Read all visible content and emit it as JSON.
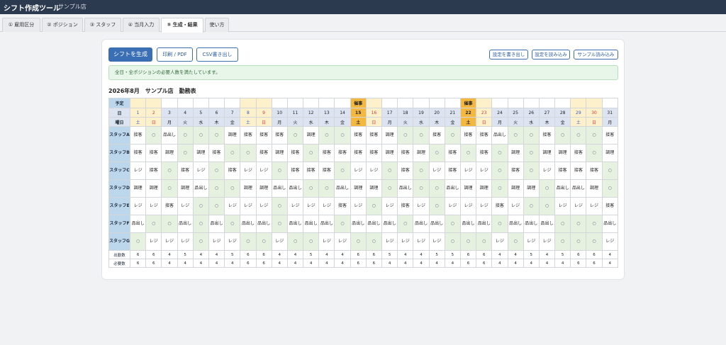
{
  "header": {
    "title": "シフト作成ツール",
    "store": "サンプル店"
  },
  "tabs": [
    {
      "label": "① 雇用区分",
      "name": "tab-employment"
    },
    {
      "label": "② ポジション",
      "name": "tab-position"
    },
    {
      "label": "③ スタッフ",
      "name": "tab-staff"
    },
    {
      "label": "④ 当月入力",
      "name": "tab-monthly-input"
    },
    {
      "label": "⑤ 生成・結果",
      "name": "tab-generate-result"
    },
    {
      "label": "使い方",
      "name": "tab-help"
    }
  ],
  "toolbar": {
    "generate": "シフトを生成",
    "print": "印刷 / PDF",
    "csv": "CSV書き出し",
    "export_settings": "設定を書き出し",
    "import_settings": "設定を読み込み",
    "load_sample": "サンプル読み込み"
  },
  "alert": "全日・全ポジションの必要人数を満たしています。",
  "sheet_title": "2026年8月　サンプル店　勤務表",
  "labels": {
    "event": "予定",
    "day": "日",
    "weekday": "曜日",
    "worked": "出勤数",
    "required": "必要数"
  },
  "days": [
    "1",
    "2",
    "3",
    "4",
    "5",
    "6",
    "7",
    "8",
    "9",
    "10",
    "11",
    "12",
    "13",
    "14",
    "15",
    "16",
    "17",
    "18",
    "19",
    "20",
    "21",
    "22",
    "23",
    "24",
    "25",
    "26",
    "27",
    "28",
    "29",
    "30",
    "31"
  ],
  "weekdays": [
    "土",
    "日",
    "月",
    "火",
    "水",
    "木",
    "金",
    "土",
    "日",
    "月",
    "火",
    "水",
    "木",
    "金",
    "土",
    "日",
    "月",
    "火",
    "水",
    "木",
    "金",
    "土",
    "日",
    "月",
    "火",
    "水",
    "木",
    "金",
    "土",
    "日",
    "月"
  ],
  "events": [
    "",
    "",
    "",
    "",
    "",
    "",
    "",
    "",
    "",
    "",
    "",
    "",
    "",
    "",
    "催事",
    "",
    "",
    "",
    "",
    "",
    "",
    "催事",
    "",
    "",
    "",
    "",
    "",
    "",
    "",
    "",
    ""
  ],
  "staff": [
    {
      "name": "スタッフA",
      "shifts": [
        "接客",
        "○",
        "品出し",
        "○",
        "○",
        "○",
        "調理",
        "接客",
        "接客",
        "接客",
        "○",
        "調理",
        "○",
        "○",
        "接客",
        "接客",
        "調理",
        "○",
        "○",
        "接客",
        "○",
        "接客",
        "接客",
        "品出し",
        "○",
        "○",
        "接客",
        "○",
        "○",
        "○",
        "接客"
      ]
    },
    {
      "name": "スタッフB",
      "shifts": [
        "接客",
        "接客",
        "調理",
        "○",
        "調理",
        "接客",
        "○",
        "○",
        "接客",
        "調理",
        "接客",
        "○",
        "接客",
        "接客",
        "接客",
        "接客",
        "調理",
        "接客",
        "調理",
        "○",
        "接客",
        "○",
        "接客",
        "○",
        "調理",
        "○",
        "調理",
        "調理",
        "接客",
        "○",
        "調理"
      ]
    },
    {
      "name": "スタッフC",
      "shifts": [
        "レジ",
        "接客",
        "○",
        "接客",
        "レジ",
        "○",
        "接客",
        "レジ",
        "レジ",
        "○",
        "接客",
        "接客",
        "接客",
        "○",
        "レジ",
        "レジ",
        "○",
        "接客",
        "○",
        "レジ",
        "接客",
        "レジ",
        "レジ",
        "○",
        "接客",
        "○",
        "レジ",
        "接客",
        "接客",
        "接客",
        "○"
      ]
    },
    {
      "name": "スタッフD",
      "shifts": [
        "調理",
        "調理",
        "○",
        "調理",
        "品出し",
        "○",
        "○",
        "調理",
        "調理",
        "品出し",
        "品出し",
        "○",
        "○",
        "品出し",
        "調理",
        "調理",
        "○",
        "品出し",
        "○",
        "○",
        "品出し",
        "調理",
        "調理",
        "○",
        "調理",
        "調理",
        "○",
        "品出し",
        "品出し",
        "調理",
        "○"
      ]
    },
    {
      "name": "スタッフE",
      "shifts": [
        "レジ",
        "レジ",
        "接客",
        "レジ",
        "○",
        "○",
        "レジ",
        "レジ",
        "レジ",
        "○",
        "レジ",
        "レジ",
        "レジ",
        "接客",
        "レジ",
        "○",
        "レジ",
        "接客",
        "レジ",
        "○",
        "レジ",
        "レジ",
        "レジ",
        "接客",
        "レジ",
        "○",
        "○",
        "レジ",
        "レジ",
        "レジ",
        "接客"
      ]
    },
    {
      "name": "スタッフF",
      "shifts": [
        "品出し",
        "○",
        "○",
        "品出し",
        "○",
        "品出し",
        "○",
        "品出し",
        "品出し",
        "○",
        "品出し",
        "品出し",
        "品出し",
        "○",
        "品出し",
        "品出し",
        "品出し",
        "○",
        "品出し",
        "品出し",
        "○",
        "品出し",
        "品出し",
        "○",
        "品出し",
        "品出し",
        "品出し",
        "○",
        "○",
        "○",
        "品出し"
      ]
    },
    {
      "name": "スタッフG",
      "shifts": [
        "○",
        "レジ",
        "レジ",
        "レジ",
        "○",
        "レジ",
        "レジ",
        "○",
        "○",
        "レジ",
        "○",
        "○",
        "レジ",
        "レジ",
        "○",
        "○",
        "レジ",
        "レジ",
        "レジ",
        "レジ",
        "○",
        "○",
        "○",
        "レジ",
        "○",
        "レジ",
        "レジ",
        "○",
        "○",
        "○",
        "レジ"
      ]
    }
  ],
  "worked": [
    "6",
    "6",
    "4",
    "5",
    "4",
    "4",
    "5",
    "6",
    "6",
    "4",
    "4",
    "5",
    "4",
    "4",
    "6",
    "6",
    "5",
    "4",
    "4",
    "5",
    "5",
    "6",
    "6",
    "4",
    "4",
    "5",
    "4",
    "5",
    "6",
    "6",
    "4"
  ],
  "required": [
    "6",
    "6",
    "4",
    "4",
    "4",
    "4",
    "4",
    "6",
    "6",
    "4",
    "4",
    "4",
    "4",
    "4",
    "6",
    "6",
    "4",
    "4",
    "4",
    "4",
    "4",
    "6",
    "6",
    "4",
    "4",
    "4",
    "4",
    "4",
    "6",
    "6",
    "4"
  ]
}
